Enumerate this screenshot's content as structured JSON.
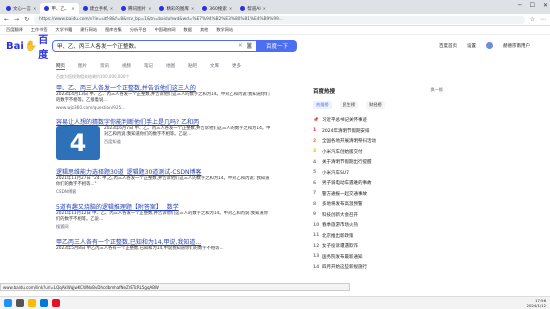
{
  "tabs": [
    {
      "label": "文心一言",
      "active": false
    },
    {
      "label": "甲、乙、",
      "active": true
    },
    {
      "label": "建立手机",
      "active": false
    },
    {
      "label": "腾讯图片",
      "active": false
    },
    {
      "label": "精彩的图库",
      "active": false
    },
    {
      "label": "360搜索",
      "active": false
    },
    {
      "label": "帮道AI",
      "active": false
    }
  ],
  "address": {
    "url": "https://www.baidu.com/s?ie=utf-8&f=8&rsv_bp=1&tn=baiduhwd&wd=%E7%94%B2%E3%80%81%E4%B9%99..."
  },
  "bookmarks": [
    "百度翻译",
    "工作书签",
    "大学书籍",
    "建行网站",
    "图库合集",
    "分析平台",
    "中国政府网",
    "数据",
    "其他",
    "数学网站"
  ],
  "search": {
    "logo_left": "Bai",
    "logo_right": "百度",
    "query": "甲、乙、丙三人各发一个正整数。",
    "button": "百度一下"
  },
  "top_right": {
    "links": [
      "百度首页",
      "设置"
    ],
    "user": "赫德宗南用户"
  },
  "filter_tabs": [
    "网页",
    "图片",
    "资讯",
    "视频",
    "笔记",
    "地图",
    "贴吧",
    "文库",
    "更多"
  ],
  "result_info": "百度为您找到相关结果约100,000,000个",
  "results": [
    {
      "title": "甲、乙、丙三人各发一个正整数,并告诉他们这三人的",
      "abstract": "2023年4月13日 甲、乙、丙三人各发一个正整数,并告诉他们这三人的数字之和为14。甲对乙和丙说:我知道你们的数字不相等。乙接着说...",
      "source": "www.wjz360.com/question/925..."
    },
    {
      "title": "容易让人想的猜数字你能判断他们手上是几吗? 乙和丙",
      "abstract": "2023年6月7日 甲、乙、丙三人各发一个正整数,并告诉他们这三人的数字之和为14。甲对乙和丙说:我知道你们的数字不相等。乙说...",
      "source": "百度知道",
      "thumb": "4"
    },
    {
      "title": "逻辑思维能力选择题30道_逻辑题30道测试-CSDN博客",
      "abstract": "2021年11月27日 \"24. 甲,乙,丙三人各发一个正整数,并告诉他们这三人的数字之和为14。甲对乙和丙说: 我知道你们的数字不相等...\"",
      "source": "CSDN博客"
    },
    {
      "title": "5道有趣又烧脑的逻辑推理题【附答案】_ 数学",
      "abstract": "2021年11月12日 甲、乙、丙三人各发一个正整数,并告诉他们这三人的数字之和为14。甲对乙和丙说:我知道你们的数字不相等。乙说...",
      "source": "搜狐网"
    },
    {
      "title": "甲乙丙三人各有一个正整数,已知和为14,甲说,我知道...",
      "abstract": "2023年5月8日 甲乙丙三人各有一个正整数,已知和为14,甲说我知道你们的数字不相等...",
      "source": "百度知道"
    }
  ],
  "hot": {
    "title": "百度热搜",
    "switch": "换一换",
    "tabs": [
      "热搜榜",
      "民生榜",
      "财经榜"
    ],
    "items": [
      "习近平总书记关怀事迹",
      "2024年清明节假期安排",
      "全国各地开展清明祭扫活动",
      "小米汽车创始版交付",
      "关于清明节假期出行提醒",
      "小米汽车SU7",
      "男子骑电动车遇难的事故",
      "警方通报一起交通事故",
      "多地将发布高温预警",
      "科技创新大会召开",
      "春季旅游市场火热",
      "北京推出新政策",
      "女子投诉遭遇欺诈",
      "国务院发布最新通知",
      "四月开始这些新规施行"
    ]
  },
  "status_url": "www.baidu.com/link?url=LQqAkWqjwKCWNxBvDhcdbmhafNeZrETcRL5gqABW",
  "clock": {
    "time": "17:56",
    "date": "2024/1/12"
  },
  "colors": {
    "accent": "#4e6ef2",
    "link": "#2440b3",
    "highlight": "#f73131"
  }
}
